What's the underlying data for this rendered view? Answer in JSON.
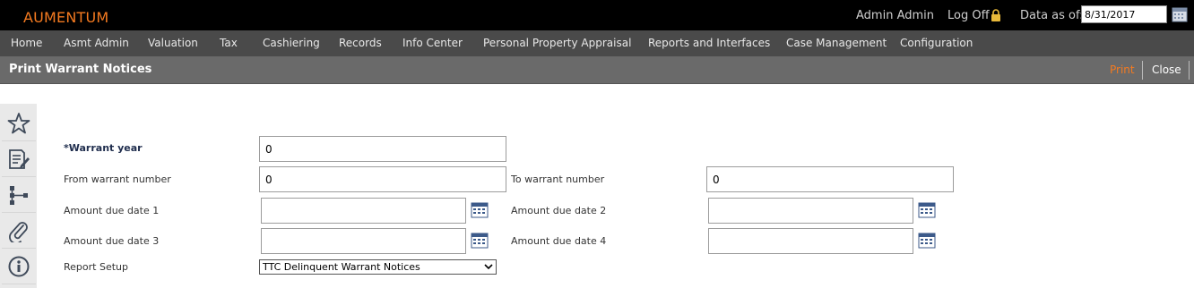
{
  "header": {
    "logo": "AUMENTUM",
    "user": "Admin Admin",
    "logoff": "Log Off",
    "data_as_of_label": "Data as of:",
    "data_as_of_value": "8/31/2017"
  },
  "menu": [
    "Home",
    "Asmt Admin",
    "Valuation",
    "Tax",
    "Cashiering",
    "Records",
    "Info Center",
    "Personal Property Appraisal",
    "Reports and Interfaces",
    "Case Management",
    "Configuration"
  ],
  "titlebar": {
    "title": "Print Warrant Notices",
    "print": "Print",
    "close": "Close"
  },
  "sidebar": [
    "star-icon",
    "edit-document-icon",
    "hierarchy-icon",
    "attachment-icon",
    "info-icon"
  ],
  "form": {
    "warrant_year": {
      "label": "*Warrant year",
      "value": "0"
    },
    "from_warrant_number": {
      "label": "From warrant number",
      "value": "0"
    },
    "to_warrant_number": {
      "label": "To warrant number",
      "value": "0"
    },
    "amount_due_date_1": {
      "label": "Amount due date 1",
      "value": ""
    },
    "amount_due_date_2": {
      "label": "Amount due date 2",
      "value": ""
    },
    "amount_due_date_3": {
      "label": "Amount due date 3",
      "value": ""
    },
    "amount_due_date_4": {
      "label": "Amount due date 4",
      "value": ""
    },
    "report_setup": {
      "label": "Report Setup",
      "value": "TTC Delinquent Warrant Notices"
    }
  },
  "colors": {
    "accent": "#f47a20",
    "topbar": "#000000",
    "menubar": "#4a4a4a",
    "titlebar": "#6a6a6a"
  }
}
